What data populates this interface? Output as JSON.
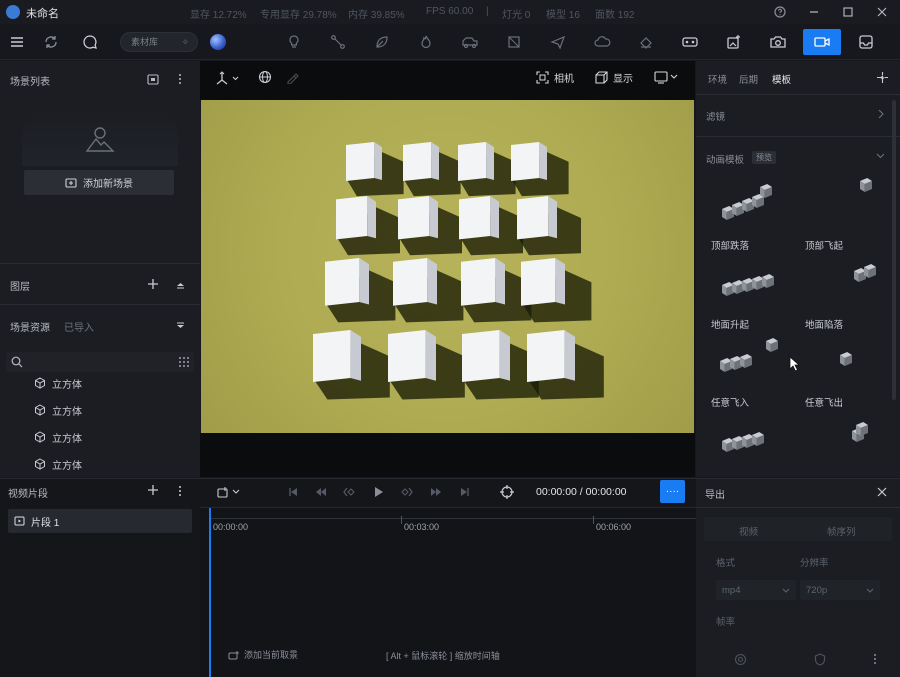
{
  "app": {
    "title": "未命名",
    "stats": [
      {
        "label": "显存 12.72%"
      },
      {
        "label": "专用显存 29.78%"
      },
      {
        "label": "内存 39.85%"
      },
      {
        "label": "FPS 60.00"
      },
      {
        "label": "|"
      },
      {
        "label": "灯光 0"
      },
      {
        "label": "模型 16"
      },
      {
        "label": "面数 192"
      }
    ]
  },
  "toolbar": {
    "pill_label": "素材库",
    "icons": [
      "menu-icon",
      "refresh-icon",
      "chat-icon",
      "globe-icon",
      "bulb-icon",
      "path-icon",
      "leaf-icon",
      "flame-icon",
      "vehicle-icon",
      "box-icon",
      "plane-icon",
      "cloud-icon",
      "paint-icon",
      "vr-icon",
      "sparkle-icon",
      "camera-icon",
      "video-camera-icon",
      "inbox-icon"
    ]
  },
  "left": {
    "scene_list_title": "场景列表",
    "add_scene_label": "添加新场景",
    "layers_title": "图层",
    "assets_title": "场景资源",
    "assets_imported": "已导入",
    "tree_items": [
      "立方体",
      "立方体",
      "立方体",
      "立方体"
    ]
  },
  "viewport": {
    "camera_label": "相机",
    "display_label": "显示"
  },
  "right": {
    "tabs": [
      "环境",
      "后期",
      "模板"
    ],
    "filter_label": "滤镜",
    "anim_title": "动画模板",
    "anim_badge": "预览",
    "anims": [
      "顶部跌落",
      "顶部飞起",
      "地面升起",
      "地面陷落",
      "任意飞入",
      "任意飞出"
    ]
  },
  "timeline": {
    "title": "视频片段",
    "clip_label": "片段 1",
    "timecode": "00:00:00 / 00:00:00",
    "ticks": [
      "00:00:00",
      "00:03:00",
      "00:06:00"
    ],
    "add_current_label": "添加当前取景",
    "hint": "[ Alt + 鼠标滚轮 ] 缩放时间轴",
    "more_label": "····"
  },
  "export": {
    "title": "导出",
    "modes": [
      "视频",
      "帧序列"
    ],
    "format_label": "格式",
    "resolution_label": "分辨率",
    "format_value": "mp4",
    "resolution_value": "720p",
    "framerate_label": "帧率"
  },
  "colors": {
    "accent": "#1a7cf2",
    "ground": "#b0ad55",
    "panel": "#1b1d22"
  }
}
